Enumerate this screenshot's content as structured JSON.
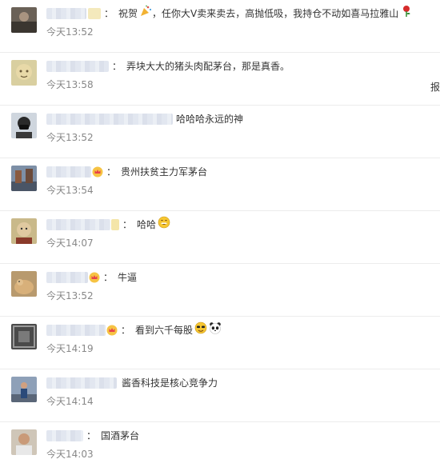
{
  "comments": [
    {
      "text": "祝贺",
      "text_tail": "，任你大V卖来卖去，高抛低吸，我持仓不动如喜马拉雅山",
      "time": "今天13:52"
    },
    {
      "text": "弄块大大的猪头肉配茅台，那是真香。",
      "time": "今天13:58"
    },
    {
      "text": "哈哈哈永远的神",
      "time": "今天13:52"
    },
    {
      "text": "贵州扶贫主力军茅台",
      "time": "今天13:54"
    },
    {
      "text": "哈哈",
      "time": "今天14:07"
    },
    {
      "text": "牛逼",
      "time": "今天13:52"
    },
    {
      "text": "看到六千每股",
      "time": "今天14:19"
    },
    {
      "text": "酱香科技是核心竞争力",
      "time": "今天14:14"
    },
    {
      "text": "国酒茅台",
      "time": "今天14:03"
    }
  ],
  "separator": "：",
  "edge_char": "报",
  "icons": {
    "celebrate": "party-popper-icon",
    "rose": "rose-icon",
    "crown": "crown-badge-icon",
    "grin": "grin-emoji-icon",
    "shades": "sunglasses-emoji-icon",
    "panda": "panda-emoji-icon"
  },
  "colors": {
    "time": "#888888",
    "divider": "#ececec",
    "text": "#333333"
  }
}
